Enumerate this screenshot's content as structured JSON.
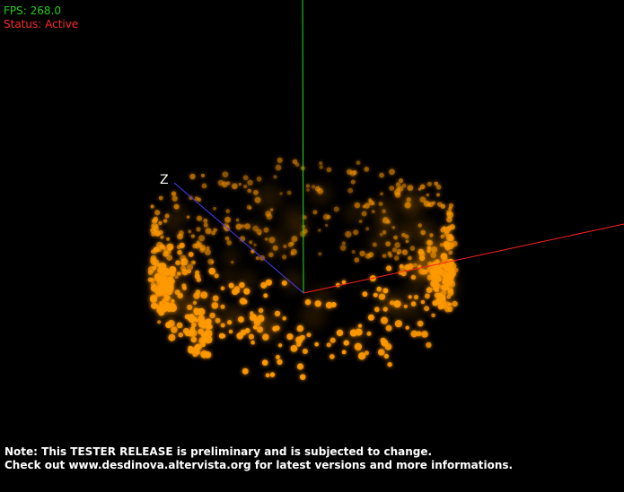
{
  "hud": {
    "fps_label": "FPS: 268.0",
    "status_label": "Status: Active",
    "fps_color": "#22cc22",
    "status_color": "#ff2a2a"
  },
  "axes": {
    "z_label": "Z",
    "x_color": "#ff2020",
    "y_color": "#20e020",
    "z_color": "#4a3cff"
  },
  "particles": {
    "color": "#ff9900",
    "glow_color": "#ff8a00"
  },
  "notice": {
    "line1": "Note: This TESTER RELEASE is preliminary and is subjected to change.",
    "line2": "Check out www.desdinova.altervista.org for latest versions and more informations."
  }
}
